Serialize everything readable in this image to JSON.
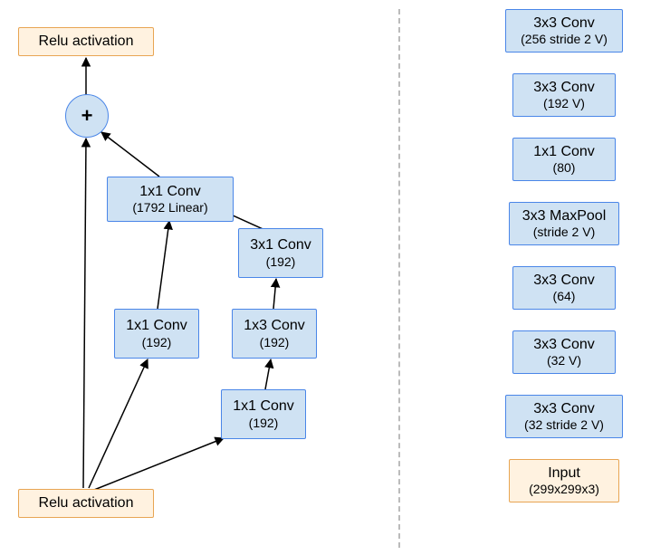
{
  "left": {
    "relu_top": "Relu activation",
    "relu_bottom": "Relu activation",
    "plus": "+",
    "conv_main_l1": "1x1 Conv",
    "conv_main_l2": "(1792 Linear)",
    "branch1_l1": "1x1 Conv",
    "branch1_l2": "(192)",
    "branch2_top_l1": "3x1 Conv",
    "branch2_top_l2": "(192)",
    "branch2_mid_l1": "1x3 Conv",
    "branch2_mid_l2": "(192)",
    "branch2_bot_l1": "1x1 Conv",
    "branch2_bot_l2": "(192)"
  },
  "right": {
    "n0_l1": "3x3 Conv",
    "n0_l2": "(256 stride 2 V)",
    "n1_l1": "3x3 Conv",
    "n1_l2": "(192 V)",
    "n2_l1": "1x1 Conv",
    "n2_l2": "(80)",
    "n3_l1": "3x3 MaxPool",
    "n3_l2": "(stride 2 V)",
    "n4_l1": "3x3 Conv",
    "n4_l2": "(64)",
    "n5_l1": "3x3 Conv",
    "n5_l2": "(32 V)",
    "n6_l1": "3x3 Conv",
    "n6_l2": "(32 stride 2 V)",
    "input_l1": "Input",
    "input_l2": "(299x299x3)"
  }
}
